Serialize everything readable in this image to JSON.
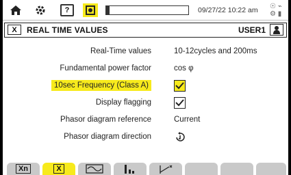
{
  "topbar": {
    "help_label": "?",
    "datetime": "09/27/22 10:22 am",
    "tray": "☉ ⌁ ⚙ ▮",
    "progress_fraction": 0.04
  },
  "title": {
    "icon_label": "X",
    "text": "REAL TIME VALUES",
    "user": "USER1"
  },
  "settings": [
    {
      "label": "Real-Time values",
      "value": "10-12cycles and 200ms"
    },
    {
      "label": "Fundamental power factor",
      "value": "cos φ"
    },
    {
      "label": "10sec Frequency (Class A)",
      "checked": true
    },
    {
      "label": "Display flagging",
      "checked": true
    },
    {
      "label": "Phasor diagram reference",
      "value": "Current"
    },
    {
      "label": "Phasor diagram direction",
      "value": ""
    }
  ],
  "softkeys": [
    {
      "label": "Xn"
    },
    {
      "label": "X"
    },
    {
      "label": ""
    },
    {
      "label": ""
    },
    {
      "label": ""
    },
    {
      "label": ""
    },
    {
      "label": ""
    },
    {
      "label": ""
    }
  ],
  "colors": {
    "accent": "#f7ea1c",
    "softkey": "#c9c9c9"
  },
  "icons": [
    "home-icon",
    "settings-icon",
    "help-icon",
    "camera-icon",
    "user-icon",
    "rotation-direction-icon",
    "waveform-icon",
    "bar-chart-icon",
    "phasor-icon"
  ]
}
